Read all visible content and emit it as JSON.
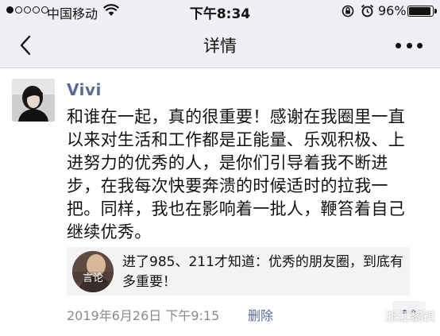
{
  "status_bar": {
    "carrier": "中国移动",
    "time": "下午8:34",
    "battery": "96%"
  },
  "nav": {
    "title": "详情"
  },
  "post": {
    "username": "Vivi",
    "text": "和谁在一起，真的很重要！感谢在我圈里一直以来对生活和工作都是正能量、乐观积极、上进努力的优秀的人，是你们引导着我不断进步，在我每次快要奔溃的时候适时的拉我一把。同样，我也在影响着一批人，鞭笞着自己继续优秀。",
    "link_title": "进了985、211才知道：优秀的朋友圈，到底有多重要！",
    "link_thumb_text": "言论",
    "timestamp": "2019年6月26日  下午9:15",
    "delete_label": "删除"
  },
  "watermark": {
    "text": "浙江黎祺"
  },
  "colors": {
    "link_blue": "#576b95",
    "bar_gray": "#efeff4"
  }
}
